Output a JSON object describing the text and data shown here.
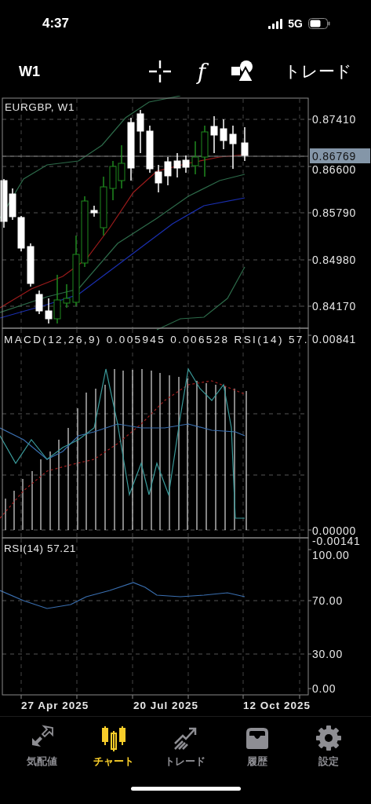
{
  "status_bar": {
    "time": "4:37",
    "network": "5G"
  },
  "toolbar": {
    "timeframe": "W1",
    "indicator_button": "f",
    "trade_button": "トレード"
  },
  "chart": {
    "main": {
      "label": "EURGBP, W1",
      "ticks": [
        "0.87410",
        "0.86600",
        "0.85790",
        "0.84980",
        "0.84170"
      ],
      "current_price": "0.86769"
    },
    "macd": {
      "label": "MACD(12,26,9) 0.005945 0.006528 RSI(14) 57.",
      "ticks": [
        "0.00841",
        "0.00000",
        "-0.00141"
      ]
    },
    "rsi": {
      "label": "RSI(14) 57.21",
      "ticks": [
        "100.00",
        "70.00",
        "30.00",
        "0.00"
      ]
    },
    "dates": [
      "27 Apr 2025",
      "20 Jul 2025",
      "12 Oct 2025"
    ]
  },
  "tabs": [
    {
      "label": "気配値",
      "kind": "quotes",
      "selected": false
    },
    {
      "label": "チャート",
      "kind": "chart",
      "selected": true
    },
    {
      "label": "トレード",
      "kind": "trade",
      "selected": false
    },
    {
      "label": "履歴",
      "kind": "history",
      "selected": false
    },
    {
      "label": "設定",
      "kind": "settings",
      "selected": false
    }
  ]
}
